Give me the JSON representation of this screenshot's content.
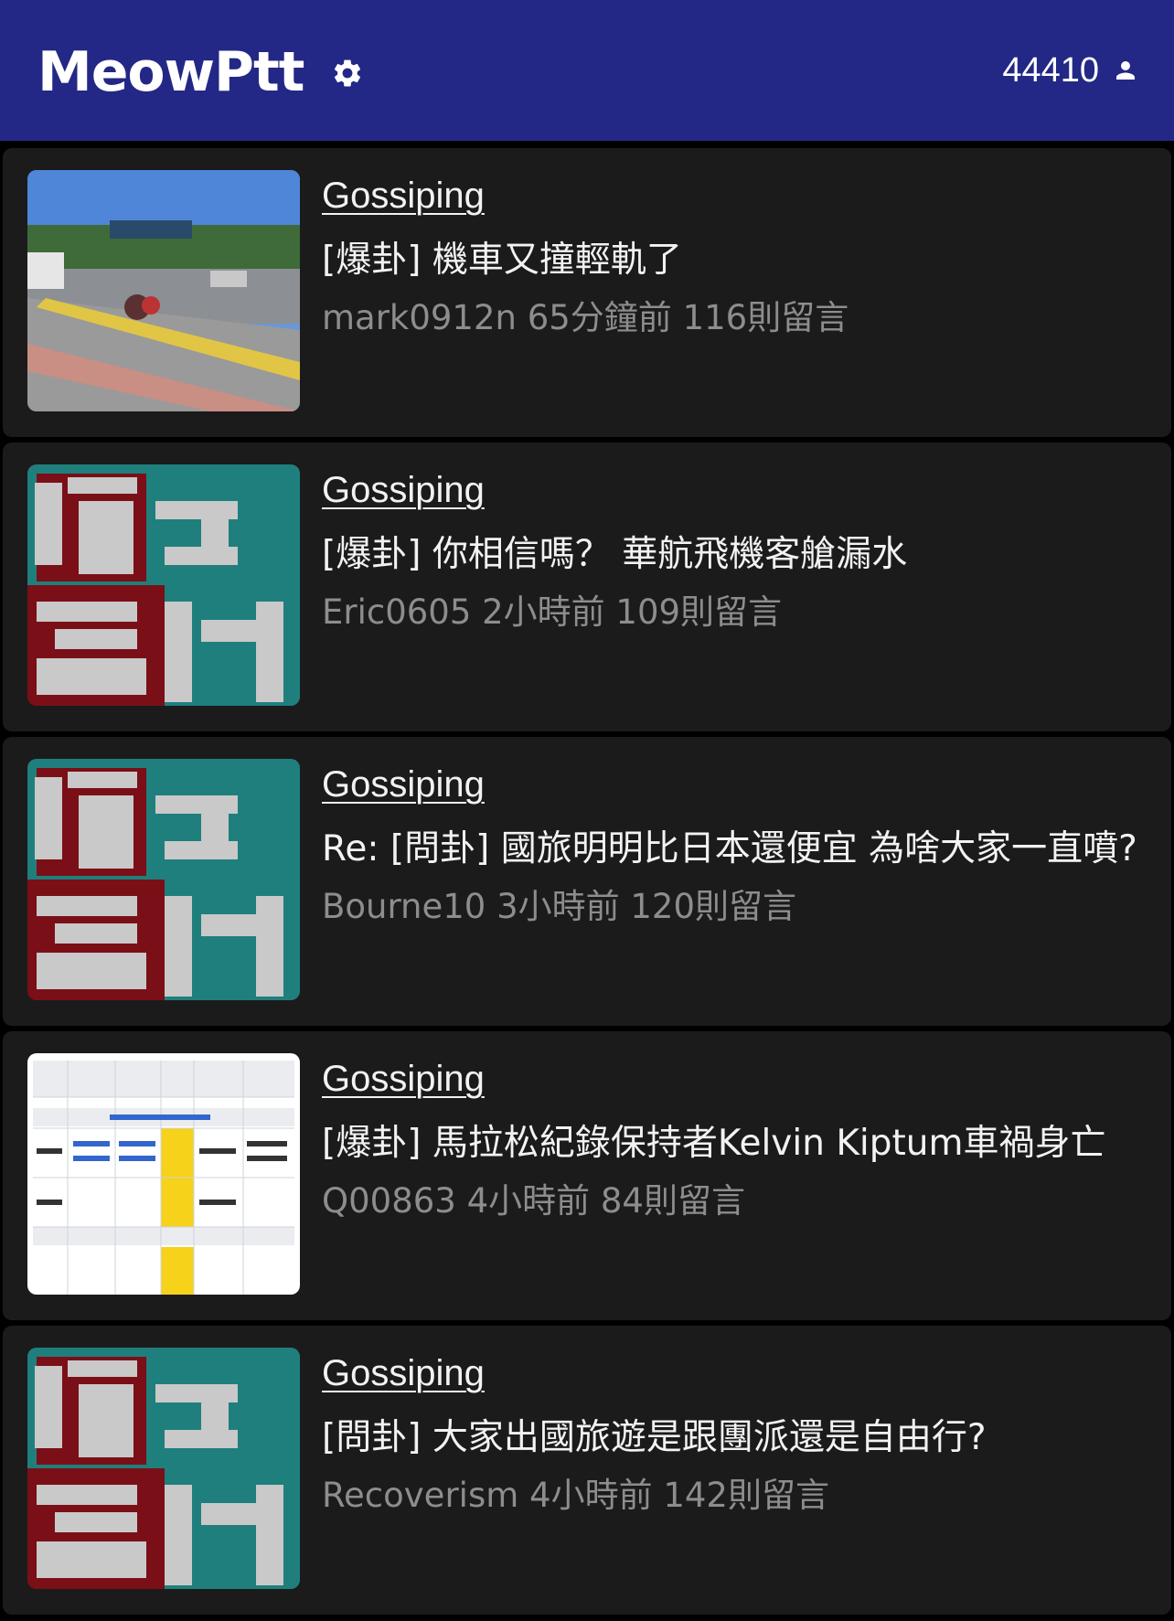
{
  "app": {
    "title": "MeowPtt",
    "user_count": "44410",
    "colors": {
      "header_bg": "#232886",
      "card_bg": "#1b1b1b",
      "text": "#f2f2f2",
      "meta": "#8d8d8d"
    },
    "icons": {
      "settings": "gear-icon",
      "user": "person-icon"
    }
  },
  "posts": [
    {
      "board": "Gossiping",
      "title": "[爆卦] 機車又撞輕軌了",
      "meta": "mark0912n 65分鐘前 116則留言",
      "thumbnail": "street-photo"
    },
    {
      "board": "Gossiping",
      "title": "[爆卦] 你相信嗎？ 華航飛機客艙漏水",
      "meta": "Eric0605 2小時前 109則留言",
      "thumbnail": "board-logo"
    },
    {
      "board": "Gossiping",
      "title": "Re: [問卦] 國旅明明比日本還便宜 為啥大家一直噴?",
      "meta": "Bourne10 3小時前 120則留言",
      "thumbnail": "board-logo"
    },
    {
      "board": "Gossiping",
      "title": "[爆卦] 馬拉松紀錄保持者Kelvin Kiptum車禍身亡",
      "meta": "Q00863 4小時前 84則留言",
      "thumbnail": "table-screenshot"
    },
    {
      "board": "Gossiping",
      "title": "[問卦] 大家出國旅遊是跟團派還是自由行?",
      "meta": "Recoverism 4小時前 142則留言",
      "thumbnail": "board-logo"
    }
  ]
}
